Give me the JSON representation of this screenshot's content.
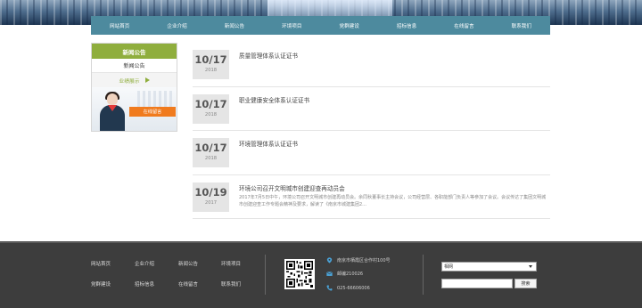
{
  "nav": {
    "items": [
      "网站首页",
      "企业介绍",
      "新闻公告",
      "环境项目",
      "党群建设",
      "招标信息",
      "在线留言",
      "联系我们"
    ]
  },
  "sidebar": {
    "heading": "新闻公告",
    "item1": "新闻公告",
    "item2": "业绩展示",
    "promo_button": "在线留言"
  },
  "news": [
    {
      "date": "10/17",
      "year": "2018",
      "title": "质量管理体系认证证书",
      "summary": ""
    },
    {
      "date": "10/17",
      "year": "2018",
      "title": "职业健康安全体系认证证书",
      "summary": ""
    },
    {
      "date": "10/17",
      "year": "2018",
      "title": "环境管理体系认证证书",
      "summary": ""
    },
    {
      "date": "10/19",
      "year": "2017",
      "title": "环境公司召开文明城市创建迎查再动员会",
      "summary": "2017年7月5日中午，环境公司召开文明城市创建再动员会。余同秋董事长主持会议，公司经营层、各职能部门负责人等参加了会议。会议传达了集团文明城市创建迎查工作专题会精神及要求，解读了《南京市城建集团2..."
    }
  ],
  "footer": {
    "links": [
      "网站首页",
      "企业介绍",
      "新闻公告",
      "环境项目",
      "党群建设",
      "招标信息",
      "在线留言",
      "联系我们"
    ],
    "address": "南京市栖霞区合作村100号",
    "postcode": "邮编210026",
    "phone": "025-66606006",
    "select_value": "相网",
    "search_button": "搜索"
  },
  "colors": {
    "nav_bg": "#4d8a9e",
    "accent_green": "#8fae3d",
    "promo_orange": "#f07b1e",
    "footer_bg": "#3d3d3d",
    "icon_blue": "#4aa3d8"
  },
  "icons": [
    "location-icon",
    "mail-icon",
    "phone-icon",
    "qr-code",
    "arrow-right-icon",
    "chevron-down-icon"
  ]
}
